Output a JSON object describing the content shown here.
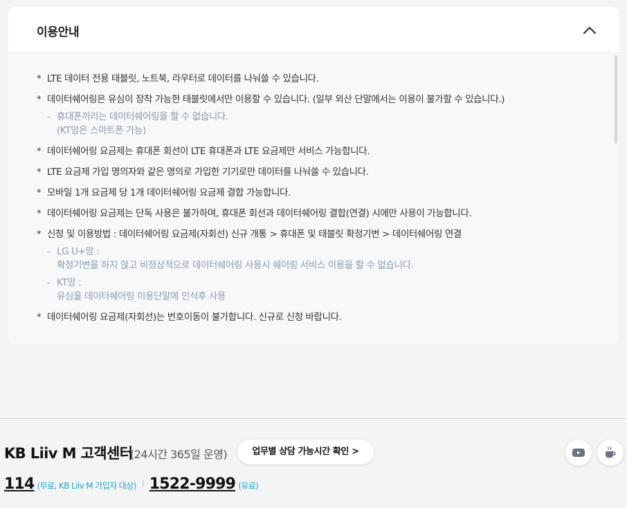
{
  "panel": {
    "title": "이용안내",
    "collapse_icon": "chevron-up-icon"
  },
  "notes": [
    {
      "bullet": "*",
      "text": "LTE 데이터 전용 태블릿, 노트북, 라우터로 데이터를 나눠쓸 수 있습니다."
    },
    {
      "bullet": "*",
      "text": "데이터쉐어링은 유심이 장착 가능한 태블릿에서만 이용할 수 있습니다. (일부 외산 단말에서는 이용이 불가할 수 있습니다.)",
      "sub": [
        {
          "dash": "-",
          "line1": "휴대폰끼리는 데이터쉐어링을 할 수 없습니다.",
          "line2": "(KT망은 스마트폰 가능)"
        }
      ]
    },
    {
      "bullet": "*",
      "text": "데이터쉐어링 요금제는 휴대폰 회선이 LTE 휴대폰과 LTE 요금제만 서비스 가능합니다."
    },
    {
      "bullet": "*",
      "text": "LTE 요금제 가입 명의자와 같은 명의로 가입한 기기로만 데이터를 나눠쓸 수 있습니다."
    },
    {
      "bullet": "*",
      "text": "모바일 1개 요금제 당 1개 데이터쉐어링 요금제 결합 가능합니다."
    },
    {
      "bullet": "*",
      "text": "데이터쉐어링 요금제는 단독 사용은 불가하며, 휴대폰 회선과 데이터쉐어링 결합(연결) 시에만 사용이 가능합니다."
    },
    {
      "bullet": "*",
      "text": "신청 및 이용방법 : 데이터쉐어링 요금제(자회선) 신규 개통 > 휴대폰 및 태블릿 확정기변 > 데이터쉐어링 연결",
      "sub": [
        {
          "dash": "-",
          "line1": "LG U+망 :",
          "line2": "확정기변을 하지 않고 비정상적으로 데이터쉐어링 사용시 쉐어링 서비스 이용을 할 수 없습니다."
        },
        {
          "dash": "-",
          "line1": "KT망 :",
          "line2": "유심을 데이터쉐어링 이용단말에 인식후 사용"
        }
      ]
    },
    {
      "bullet": "*",
      "text": "데이터쉐어링 요금제(자회선)는 번호이동이 불가합니다. 신규로 신청 바랍니다."
    }
  ],
  "footer": {
    "title": "KB Liiv M 고객센터",
    "hours": "(24시간 365일 운영)",
    "hours_button": "업무별 상담 가능시간 확인 >",
    "social": [
      "youtube-icon",
      "cafe-icon"
    ],
    "phones": [
      {
        "number": "114",
        "note": "(무료, KB Liiv M 가입자 대상)"
      },
      {
        "number": "1522-9999",
        "note": "(유료)"
      }
    ]
  },
  "colors": {
    "sub_text": "#8a9aab",
    "phone_note": "#2aa3c7",
    "youtube": "#6b7280",
    "background": "#f3f4f6"
  }
}
